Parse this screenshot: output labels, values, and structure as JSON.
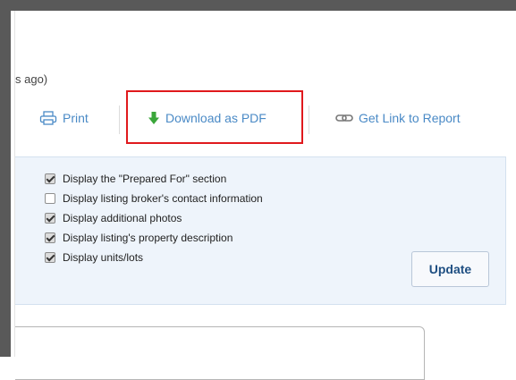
{
  "header": {
    "time_text": "s ago)"
  },
  "toolbar": {
    "print_label": "Print",
    "download_pdf_label": "Download as PDF",
    "get_link_label": "Get Link to Report"
  },
  "options": [
    {
      "label": "Display the \"Prepared For\" section",
      "checked": true
    },
    {
      "label": "Display listing broker's contact information",
      "checked": false
    },
    {
      "label": "Display additional photos",
      "checked": true
    },
    {
      "label": "Display listing's property description",
      "checked": true
    },
    {
      "label": "Display units/lots",
      "checked": true
    }
  ],
  "update_button_label": "Update",
  "colors": {
    "link_blue": "#4a8ac6",
    "download_arrow_green": "#3aa63a",
    "highlight_red": "#e0191d",
    "panel_bg": "#eef4fb",
    "frame_dark": "#595959"
  },
  "icons": {
    "print": "printer-icon",
    "download": "download-arrow-icon",
    "link": "chain-link-icon"
  }
}
